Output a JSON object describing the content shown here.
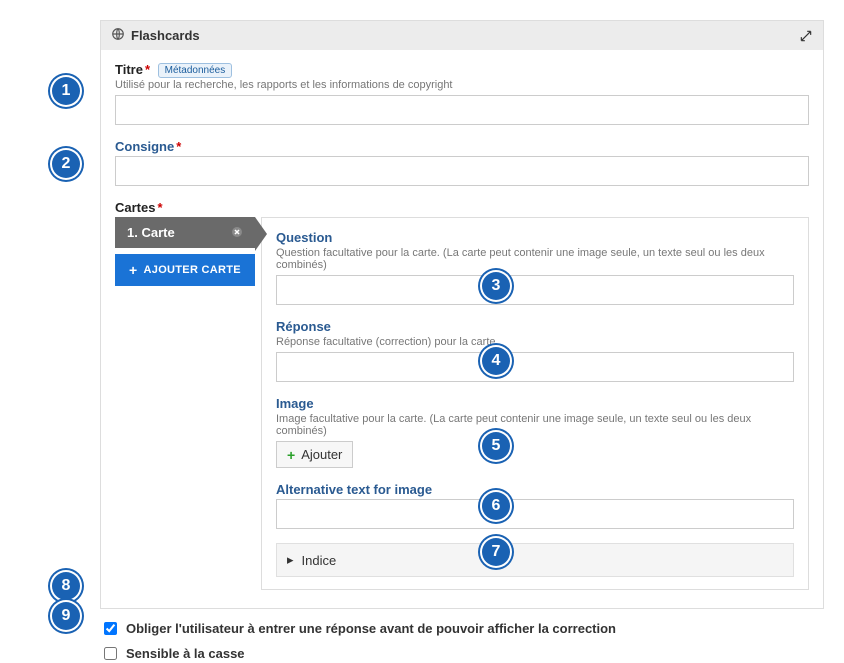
{
  "header": {
    "title": "Flashcards"
  },
  "titre": {
    "label": "Titre",
    "badge": "Métadonnées",
    "hint": "Utilisé pour la recherche, les rapports et les informations de copyright",
    "value": ""
  },
  "consigne": {
    "label": "Consigne",
    "value": ""
  },
  "cartes": {
    "label": "Cartes",
    "tab_label": "1. Carte",
    "add_button": "AJOUTER CARTE"
  },
  "card": {
    "question": {
      "title": "Question",
      "hint": "Question facultative pour la carte. (La carte peut contenir une image seule, un texte seul ou les deux combinés)",
      "value": ""
    },
    "reponse": {
      "title": "Réponse",
      "hint": "Réponse facultative (correction) pour la carte.",
      "value": ""
    },
    "image": {
      "title": "Image",
      "hint": "Image facultative pour la carte. (La carte peut contenir une image seule, un texte seul ou les deux combinés)",
      "add_label": "Ajouter"
    },
    "alt": {
      "title": "Alternative text for image",
      "value": ""
    },
    "indice": {
      "label": "Indice"
    }
  },
  "options": {
    "force_answer": "Obliger l'utilisateur à entrer une réponse avant de pouvoir afficher la correction",
    "case_sensitive": "Sensible à la casse"
  },
  "markers": {
    "1": "1",
    "2": "2",
    "3": "3",
    "4": "4",
    "5": "5",
    "6": "6",
    "7": "7",
    "8": "8",
    "9": "9"
  }
}
